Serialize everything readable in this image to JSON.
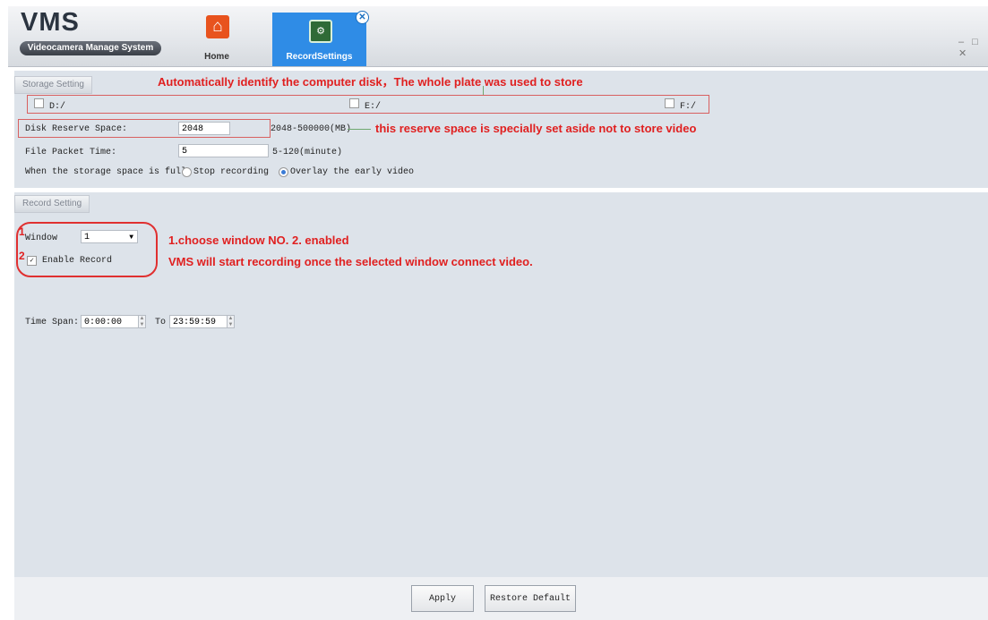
{
  "app": {
    "title": "VMS",
    "subtitle": "Videocamera Manage System",
    "window_controls": "– □ ✕"
  },
  "tabs": [
    {
      "label": "Home",
      "icon": "home-icon"
    },
    {
      "label": "RecordSettings",
      "icon": "record-settings-icon",
      "active": true
    }
  ],
  "storage": {
    "section_title": "Storage Setting",
    "disks": [
      "D:/",
      "E:/",
      "F:/"
    ],
    "reserve_label": "Disk Reserve Space:",
    "reserve_value": "2048",
    "reserve_range": "2048-500000(MB)",
    "packet_label": "File Packet Time:",
    "packet_value": "5",
    "packet_range": "5-120(minute)",
    "full_label": "When the storage space is full",
    "full_options": [
      "Stop recording",
      "Overlay the early video"
    ],
    "full_selected": "Overlay the early video"
  },
  "record": {
    "section_title": "Record Setting",
    "window_label": "Window",
    "window_value": "1",
    "enable_label": "Enable Record",
    "enable_checked": true,
    "timespan_label": "Time Span:",
    "time_from": "0:00:00",
    "to_label": "To",
    "time_to": "23:59:59"
  },
  "annotations": {
    "disk_note": "Automatically identify the computer disk，The whole plate was used to store",
    "reserve_note": "this reserve space is specially set aside not to store video",
    "steps_note_1": "1.choose window NO.  2. enabled",
    "steps_note_2": "VMS will start recording once the selected window connect video.",
    "marker_1": "1",
    "marker_2": "2"
  },
  "buttons": {
    "apply": "Apply",
    "restore": "Restore Default"
  },
  "colors": {
    "accent": "#2f8ce6",
    "annotation": "#e02020",
    "panel": "#dde3ea"
  }
}
